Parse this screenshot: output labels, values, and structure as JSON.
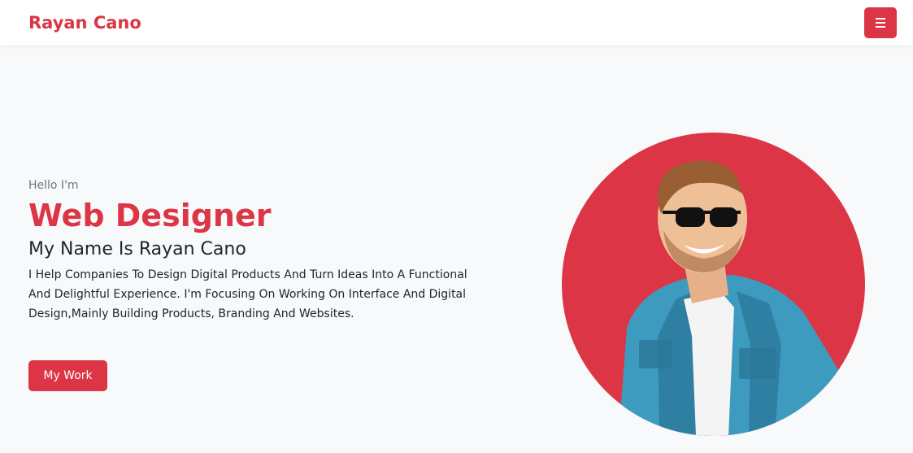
{
  "nav": {
    "brand": "Rayan Cano",
    "menu_icon": "hamburger-menu-icon"
  },
  "hero": {
    "greeting": "Hello I'm",
    "role": "Web Designer",
    "name": "My Name Is Rayan Cano",
    "description": "I Help Companies To Design Digital Products And Turn Ideas Into A Functional And Delightful Experience. I'm Focusing On Working On Interface And Digital Design,Mainly Building Products, Branding And Websites.",
    "button_label": "My Work"
  },
  "colors": {
    "accent": "#dc3545",
    "background": "#f8f9fa"
  }
}
